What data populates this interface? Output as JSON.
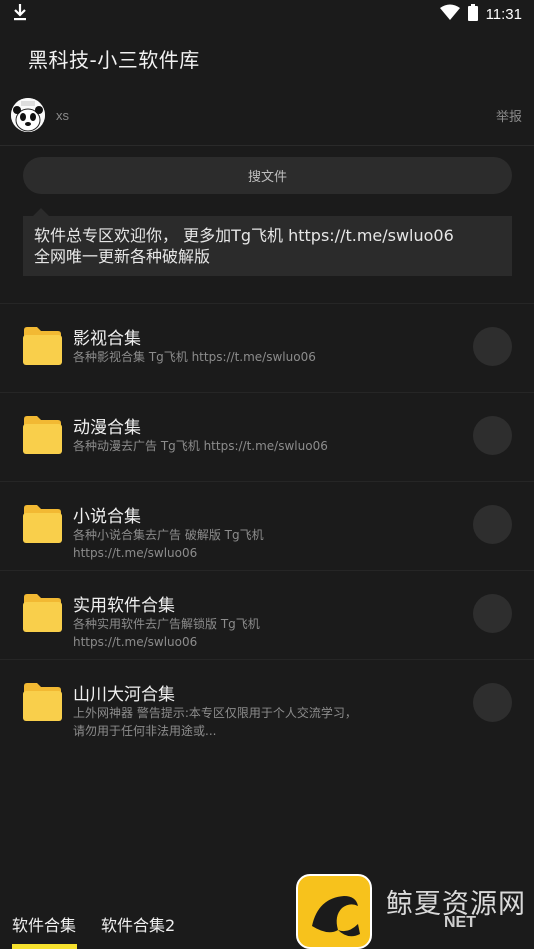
{
  "status_bar": {
    "time": "11:31",
    "left_icon": "download-icon",
    "right_icons": [
      "wifi-icon",
      "battery-icon"
    ]
  },
  "app": {
    "title": "黑科技-小三软件库"
  },
  "author": {
    "avatar_icon": "panda-avatar-icon",
    "name": "xs",
    "report_label": "举报"
  },
  "search": {
    "label": "搜文件"
  },
  "notice": {
    "line1": "软件总专区欢迎你， 更多加Tg飞机 https://t.me/swluo06",
    "line2": "全网唯一更新各种破解版"
  },
  "items": [
    {
      "title": "影视合集",
      "desc": "各种影视合集 Tg飞机 https://t.me/swluo06",
      "icon": "folder-icon"
    },
    {
      "title": "动漫合集",
      "desc": "各种动漫去广告 Tg飞机 https://t.me/swluo06",
      "icon": "folder-icon"
    },
    {
      "title": "小说合集",
      "desc": "各种小说合集去广告 破解版 Tg飞机 https://t.me/swluo06",
      "icon": "folder-icon"
    },
    {
      "title": "实用软件合集",
      "desc": "各种实用软件去广告解锁版 Tg飞机 https://t.me/swluo06",
      "icon": "folder-icon"
    },
    {
      "title": "山川大河合集",
      "desc": "上外网神器 警告提示:本专区仅限用于个人交流学习，请勿用于任何非法用途或...",
      "icon": "folder-icon"
    }
  ],
  "tabs": [
    {
      "label": "软件合集",
      "active": true
    },
    {
      "label": "软件合集2",
      "active": false
    }
  ],
  "watermark": {
    "text": "鲸夏资源网",
    "net": "NET",
    "logo_icon": "whale-logo-icon"
  },
  "colors": {
    "background": "#1b1b1b",
    "folder": "#f9cf4b",
    "tab_indicator": "#f6e12e"
  }
}
